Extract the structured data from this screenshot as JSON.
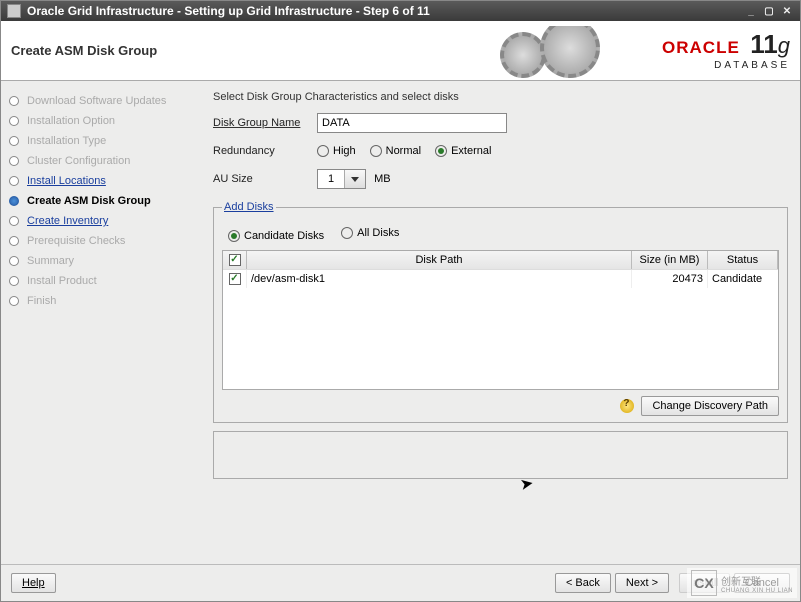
{
  "window_title": "Oracle Grid Infrastructure - Setting up Grid Infrastructure - Step 6 of 11",
  "header": {
    "page_title": "Create ASM Disk Group",
    "brand": "ORACLE",
    "product": "DATABASE",
    "version_num": "11",
    "version_suffix": "g"
  },
  "sidebar": {
    "items": [
      {
        "label": "Download Software Updates",
        "state": "disabled"
      },
      {
        "label": "Installation Option",
        "state": "disabled"
      },
      {
        "label": "Installation Type",
        "state": "disabled"
      },
      {
        "label": "Cluster Configuration",
        "state": "disabled"
      },
      {
        "label": "Install Locations",
        "state": "link"
      },
      {
        "label": "Create ASM Disk Group",
        "state": "current"
      },
      {
        "label": "Create Inventory",
        "state": "link"
      },
      {
        "label": "Prerequisite Checks",
        "state": "disabled"
      },
      {
        "label": "Summary",
        "state": "disabled"
      },
      {
        "label": "Install Product",
        "state": "disabled"
      },
      {
        "label": "Finish",
        "state": "disabled"
      }
    ]
  },
  "main": {
    "instruction": "Select Disk Group Characteristics and select disks",
    "disk_group_label": "Disk Group Name",
    "disk_group_value": "DATA",
    "redundancy_label": "Redundancy",
    "redundancy_options": {
      "high": "High",
      "normal": "Normal",
      "external": "External"
    },
    "redundancy_selected": "external",
    "au_label": "AU Size",
    "au_value": "1",
    "au_unit": "MB",
    "add_disks_legend": "Add Disks",
    "filter": {
      "candidate": "Candidate Disks",
      "all": "All Disks",
      "selected": "candidate"
    },
    "table": {
      "headers": {
        "path": "Disk Path",
        "size": "Size (in MB)",
        "status": "Status"
      },
      "rows": [
        {
          "checked": true,
          "path": "/dev/asm-disk1",
          "size": "20473",
          "status": "Candidate"
        }
      ]
    },
    "discover_btn": "Change Discovery Path"
  },
  "footer": {
    "help": "Help",
    "back": "< Back",
    "next": "Next >",
    "install": "Install",
    "cancel": "Cancel"
  },
  "watermark": {
    "text": "创新互联",
    "sub": "CHUANG XIN HU LIAN"
  }
}
